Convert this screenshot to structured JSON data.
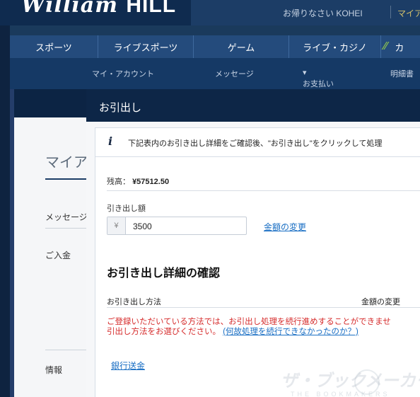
{
  "header": {
    "logo_script": "William",
    "logo_bold": "HILL",
    "greeting": "お帰りなさい KOHEI",
    "mypage": "マイア"
  },
  "main_nav": [
    "スポーツ",
    "ライブスポーツ",
    "ゲーム",
    "ライブ・カジノ",
    "カ"
  ],
  "sub_nav": [
    "マイ・アカウント",
    "メッセージ",
    "お支払い",
    "明細書"
  ],
  "side": {
    "title": "マイア",
    "links": [
      "メッセージ",
      "ご入金",
      "情報"
    ]
  },
  "modal": {
    "title": "お引出し",
    "info_text": "下記表内のお引き出し詳細をご確認後、\"お引き出し\"をクリックして処理",
    "balance_label": "残高：",
    "balance_value": "¥57512.50",
    "amount_label": "引き出し額",
    "currency_symbol": "¥",
    "amount_value": "3500",
    "change_amount_link": "金額の変更",
    "section_title": "お引き出し詳細の確認",
    "method_header": "お引き出し方法",
    "amount_change_header": "金額の変更",
    "warning_line1": "ご登録いただいている方法では、お引出し処理を続行進めすることができませ",
    "warning_line2": "引出し方法をお選びください。",
    "warning_link": "(何故処理を続行できなかったのか？)",
    "bank_transfer": "銀行送金"
  },
  "watermark": {
    "main": "ザ・ブックメーカーズ",
    "sub": "THE BOOKMAKERS"
  }
}
